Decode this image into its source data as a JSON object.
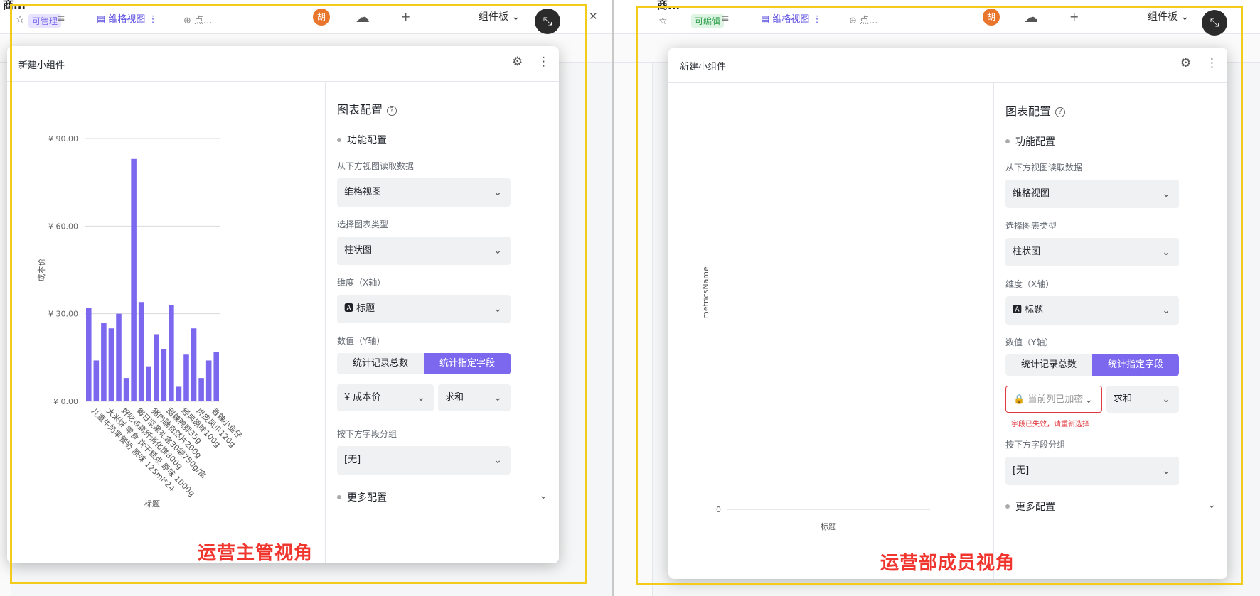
{
  "left": {
    "bg": {
      "title": "商...",
      "permission": "可管理",
      "view_tab": "维格视图",
      "add_point": "点...",
      "avatar": "胡",
      "board_tab": "组件板"
    },
    "dialog_title": "新建小组件",
    "config": {
      "title": "图表配置",
      "feature_section": "功能配置",
      "source_label": "从下方视图读取数据",
      "source_value": "维格视图",
      "type_label": "选择图表类型",
      "type_value": "柱状图",
      "x_label": "维度（X轴）",
      "x_value": "标题",
      "y_label": "数值（Y轴）",
      "y_option_count": "统计记录总数",
      "y_option_field": "统计指定字段",
      "y_field": "成本价",
      "y_agg": "求和",
      "group_label": "按下方字段分组",
      "group_value": "[无]",
      "more_section": "更多配置"
    },
    "caption": "运营主管视角"
  },
  "right": {
    "bg": {
      "title": "商...",
      "permission": "可编辑",
      "view_tab": "维格视图",
      "add_point": "点...",
      "avatar": "胡",
      "board_tab": "组件板"
    },
    "dialog_title": "新建小组件",
    "config": {
      "title": "图表配置",
      "feature_section": "功能配置",
      "source_label": "从下方视图读取数据",
      "source_value": "维格视图",
      "type_label": "选择图表类型",
      "type_value": "柱状图",
      "x_label": "维度（X轴）",
      "x_value": "标题",
      "y_label": "数值（Y轴）",
      "y_option_count": "统计记录总数",
      "y_option_field": "统计指定字段",
      "y_field": "当前列已加密",
      "y_error": "字段已失效，请重新选择",
      "y_agg": "求和",
      "group_label": "按下方字段分组",
      "group_value": "[无]",
      "more_section": "更多配置"
    },
    "caption": "运营部成员视角"
  },
  "colors": {
    "accent": "#7b68ee",
    "frame": "#f3cc1b",
    "caption": "#f0352e",
    "error": "#e0393e"
  },
  "chart_data": [
    {
      "type": "bar",
      "title": "",
      "xlabel": "标题",
      "ylabel": "成本价",
      "ylim": [
        0,
        90
      ],
      "yticks": [
        "¥ 0.00",
        "¥ 30.00",
        "¥ 60.00",
        "¥ 90.00"
      ],
      "categories": [
        "儿童牛奶早餐奶 原味 125ml*24",
        "大米饼 零食 饼干糕点 原味 1000g",
        "好吃点高纤消化饼800g",
        "每日坚果礼盒30袋750g/盒",
        "猪肉脯自然片200g",
        "甜辣鸭脖35g",
        "经典原味100g",
        "虎皮凤爪120g",
        "香辣小鱼仔"
      ],
      "values": [
        32,
        14,
        27,
        25,
        30,
        8,
        83,
        34,
        12,
        23,
        18,
        33,
        5,
        16,
        25,
        8,
        14,
        17
      ],
      "grid": true
    },
    {
      "type": "bar",
      "title": "",
      "xlabel": "标题",
      "ylabel": "metricsName",
      "yticks": [
        "0"
      ],
      "categories": [],
      "values": [],
      "grid": true
    }
  ]
}
